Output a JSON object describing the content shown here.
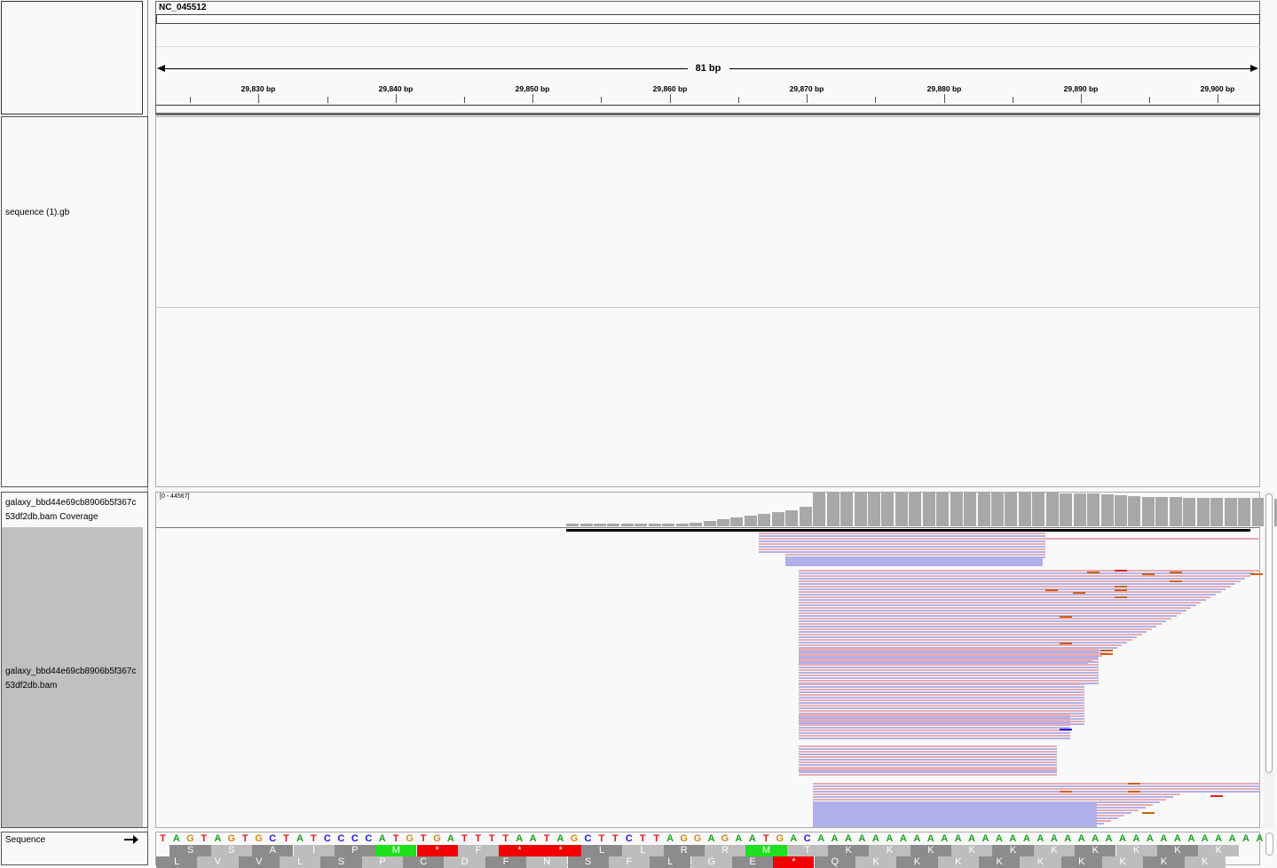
{
  "header": {
    "chromosome": "NC_045512",
    "span_label": "81 bp",
    "ticks": [
      "29,830 bp",
      "29,840 bp",
      "29,850 bp",
      "29,860 bp",
      "29,870 bp",
      "29,880 bp",
      "29,890 bp",
      "29,900 bp"
    ]
  },
  "tracks": {
    "feature_track_name": "sequence (1).gb",
    "coverage_name_line1": "galaxy_bbd44e69cb8906b5f367c",
    "coverage_name_line2": "53df2db.bam Coverage",
    "coverage_range": "[0 - 44567]",
    "alignment_name_line1": "galaxy_bbd44e69cb8906b5f367c",
    "alignment_name_line2": "53df2db.bam",
    "sequence_name": "Sequence"
  },
  "sequence": {
    "bases": "TAGTAGTGCTATCCCCATGTGATTTTAATAGCTTCTTAGGAGAATGACAAAAAAAAAAAAAAAAAAAAAAAAAAAAAAAAA",
    "frame1": [
      "S",
      "S",
      "A",
      "I",
      "P",
      "M",
      "*",
      "F",
      "*",
      "*",
      "L",
      "L",
      "R",
      "R",
      "M",
      "T",
      "K",
      "K",
      "K",
      "K",
      "K",
      "K",
      "K",
      "K",
      "K",
      "K"
    ],
    "frame2": [
      "L",
      "V",
      "V",
      "L",
      "S",
      "P",
      "C",
      "D",
      "F",
      "N",
      "S",
      "F",
      "L",
      "G",
      "E",
      "*",
      "Q",
      "K",
      "K",
      "K",
      "K",
      "K",
      "K",
      "K",
      "K",
      "K"
    ]
  },
  "colors": {
    "base_A": "#1a9e1a",
    "base_C": "#1a1adc",
    "base_G": "#d18a1a",
    "base_T": "#dc1a1a",
    "coverage_bar": "#a8a8a8",
    "read_forward": "#e8aab2",
    "read_reverse": "#b0b0ea",
    "start_codon": "#1ee01e",
    "stop_codon": "#f00000"
  },
  "icons": {
    "sequence_strand": "right-arrow-icon"
  }
}
